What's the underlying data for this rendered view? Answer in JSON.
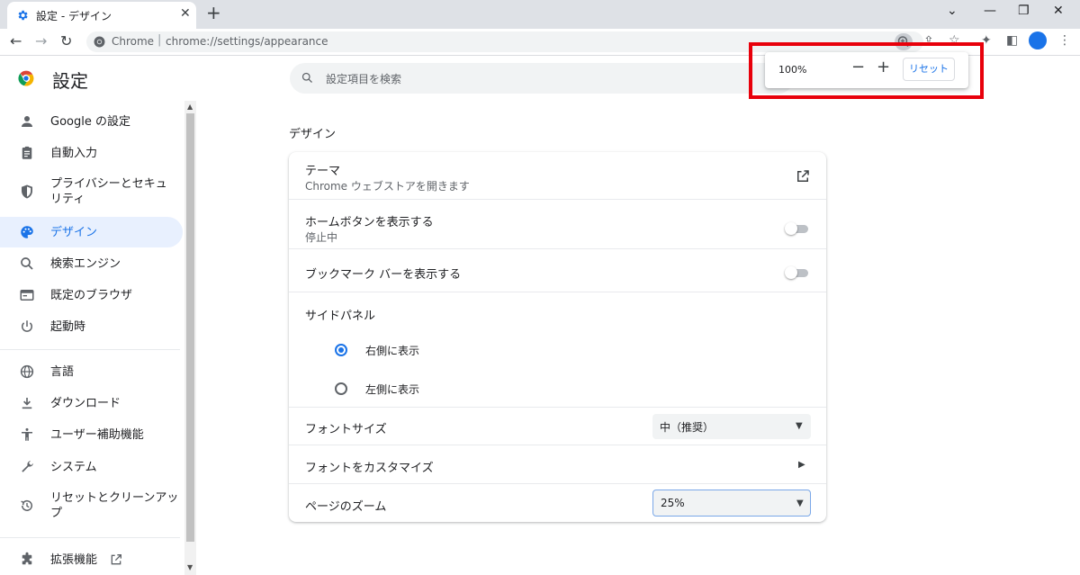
{
  "tab": {
    "title": "設定 - デザイン",
    "close": "✕"
  },
  "newtab": "+",
  "window": {
    "chevron": "⌄",
    "minimize": "—",
    "restore": "❐",
    "close": "✕"
  },
  "nav": {
    "back": "←",
    "forward": "→",
    "reload": "↻"
  },
  "omnibox": {
    "site": "Chrome",
    "separator": "|",
    "url": "chrome://settings/appearance"
  },
  "toolbar_icons": {
    "share": "⇪",
    "star": "☆",
    "extensions": "✦",
    "sidepanel": "◧",
    "menu": "⋮"
  },
  "header": {
    "title": "設定",
    "search_placeholder": "設定項目を検索"
  },
  "sidebar": {
    "items": [
      {
        "label": "Google の設定",
        "icon": "person-icon"
      },
      {
        "label": "自動入力",
        "icon": "clipboard-icon"
      },
      {
        "label": "プライバシーとセキュリティ",
        "icon": "shield-icon"
      },
      {
        "label": "デザイン",
        "icon": "palette-icon",
        "active": true
      },
      {
        "label": "検索エンジン",
        "icon": "search-icon"
      },
      {
        "label": "既定のブラウザ",
        "icon": "browser-icon"
      },
      {
        "label": "起動時",
        "icon": "power-icon"
      },
      {
        "label": "言語",
        "icon": "globe-icon"
      },
      {
        "label": "ダウンロード",
        "icon": "download-icon"
      },
      {
        "label": "ユーザー補助機能",
        "icon": "accessibility-icon"
      },
      {
        "label": "システム",
        "icon": "wrench-icon"
      },
      {
        "label": "リセットとクリーンアップ",
        "icon": "restore-icon"
      },
      {
        "label": "拡張機能",
        "icon": "puzzle-icon"
      }
    ]
  },
  "main": {
    "section_title": "デザイン",
    "theme": {
      "label": "テーマ",
      "sub": "Chrome ウェブストアを開きます"
    },
    "home_button": {
      "label": "ホームボタンを表示する",
      "sub": "停止中"
    },
    "bookmarks_bar": {
      "label": "ブックマーク バーを表示する"
    },
    "side_panel": {
      "label": "サイドパネル",
      "options": [
        {
          "label": "右側に表示",
          "checked": true
        },
        {
          "label": "左側に表示",
          "checked": false
        }
      ]
    },
    "font_size": {
      "label": "フォントサイズ",
      "value": "中（推奨）"
    },
    "customize_fonts": {
      "label": "フォントをカスタマイズ"
    },
    "page_zoom": {
      "label": "ページのズーム",
      "value": "25%"
    }
  },
  "zoom_popup": {
    "level": "100%",
    "minus": "−",
    "plus": "+",
    "reset": "リセット"
  },
  "colors": {
    "accent": "#1a73e8",
    "highlight": "#e8000b"
  }
}
